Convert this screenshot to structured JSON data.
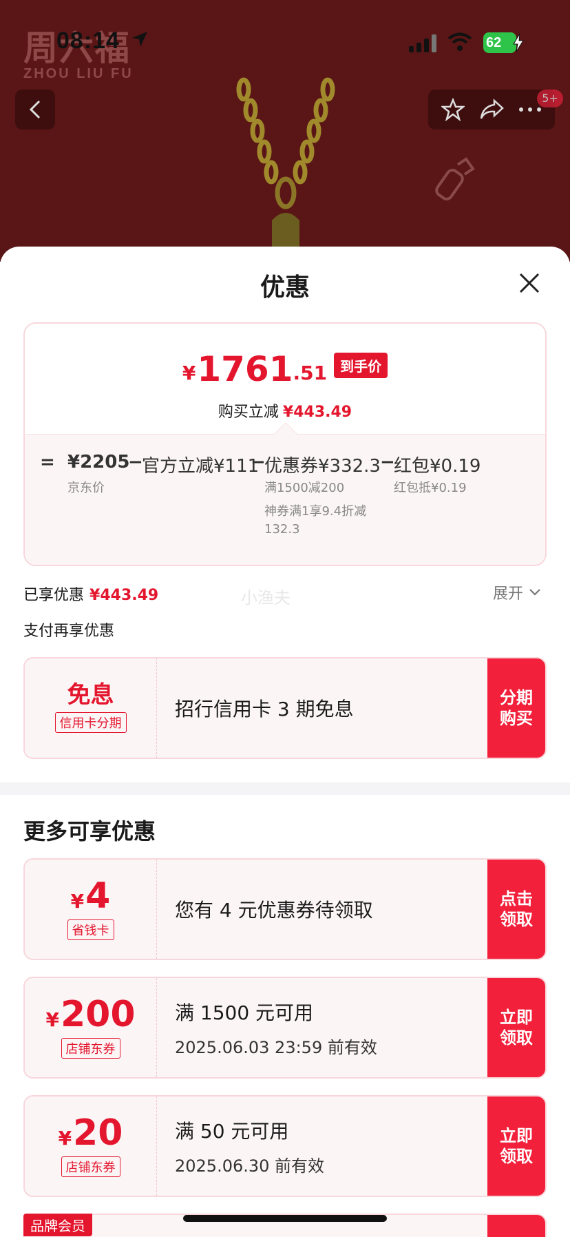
{
  "status_bar": {
    "time": "08:14",
    "battery": "62"
  },
  "backdrop": {
    "brand_cn": "周六福",
    "brand_en": "ZHOU LIU FU",
    "cart_badge": "5+"
  },
  "sheet": {
    "title": "优惠",
    "price": {
      "yen": "¥",
      "integer": "1761",
      "decimal": ".51",
      "final_tag": "到手价",
      "saving_label": "购买立减",
      "saving_amount": "¥443.49"
    },
    "breakdown": {
      "eq": "=",
      "minus": "−",
      "jd_price": "¥2205",
      "jd_price_label": "京东价",
      "official": "官方立减¥111",
      "coupon": "优惠券¥332.3",
      "coupon_sub1": "满1500减200",
      "coupon_sub2": "神券满1享9.4折减",
      "coupon_sub3": "132.3",
      "redpacket": "红包¥0.19",
      "redpacket_sub": "红包抵¥0.19"
    },
    "enjoyed_label": "已享优惠",
    "enjoyed_amount": "¥443.49",
    "watermark": "小渔夫",
    "expand_label": "展开",
    "pay_title": "支付再享优惠",
    "installment": {
      "big": "免息",
      "chip": "信用卡分期",
      "desc": "招行信用卡 3 期免息",
      "action_1": "分期",
      "action_2": "购买"
    },
    "more_title": "更多可享优惠",
    "coupons": [
      {
        "yen": "¥",
        "value": "4",
        "chip": "省钱卡",
        "line1": "您有 4 元优惠券待领取",
        "line2": "",
        "action_1": "点击",
        "action_2": "领取"
      },
      {
        "yen": "¥",
        "value": "200",
        "chip": "店铺东券",
        "line1": "满 1500 元可用",
        "line2": "2025.06.03 23:59 前有效",
        "action_1": "立即",
        "action_2": "领取"
      },
      {
        "yen": "¥",
        "value": "20",
        "chip": "店铺东券",
        "line1": "满 50 元可用",
        "line2": "2025.06.30 前有效",
        "action_1": "立即",
        "action_2": "领取"
      }
    ],
    "member_tag": "品牌会员"
  },
  "colors": {
    "accent": "#e3162e",
    "action": "#f2203a",
    "card_border": "#f8d7dc",
    "backdrop": "#5a1616"
  }
}
